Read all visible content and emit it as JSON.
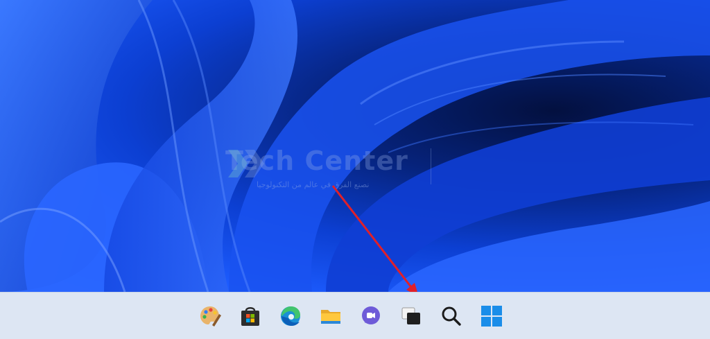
{
  "watermark": {
    "title": "Tech Center",
    "subtitle": "نصنع الفرق في عالم من التكنولوجيا"
  },
  "taskbar": {
    "icons": [
      {
        "name": "paint-icon"
      },
      {
        "name": "store-icon"
      },
      {
        "name": "edge-icon"
      },
      {
        "name": "file-explorer-icon"
      },
      {
        "name": "teams-chat-icon"
      },
      {
        "name": "task-view-icon"
      },
      {
        "name": "search-icon"
      },
      {
        "name": "start-icon"
      }
    ]
  },
  "colors": {
    "arrow": "#e0202a",
    "taskbar": "#dde6f3",
    "wallpaper_accent": "#1d5cff"
  }
}
